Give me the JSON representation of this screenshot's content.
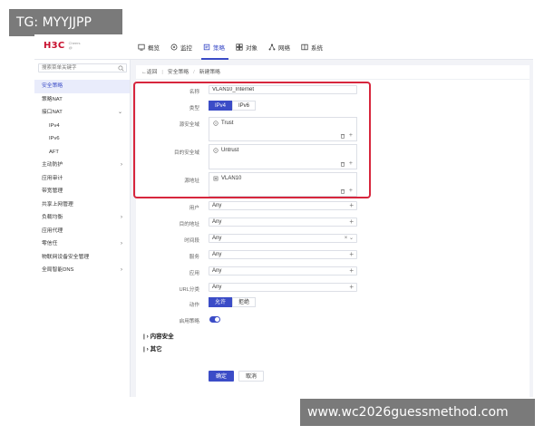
{
  "watermarks": {
    "top_left": "TG: MYYJJPP",
    "bottom_right": "www.wc2026guessmethod.com"
  },
  "brand": {
    "logo": "H3C",
    "sub": "Cheers\n@"
  },
  "nav": [
    {
      "label": "概览",
      "icon": "dashboard-icon"
    },
    {
      "label": "监控",
      "icon": "monitor-icon"
    },
    {
      "label": "策略",
      "icon": "policy-icon",
      "active": true
    },
    {
      "label": "对象",
      "icon": "object-icon"
    },
    {
      "label": "网络",
      "icon": "network-icon"
    },
    {
      "label": "系统",
      "icon": "system-icon"
    }
  ],
  "sidebar": {
    "search_placeholder": "搜索菜单关键字",
    "items": [
      {
        "label": "安全策略",
        "active": true
      },
      {
        "label": "策略NAT"
      },
      {
        "label": "接口NAT",
        "chevron": "⌄"
      },
      {
        "label": "IPv4",
        "sub": true
      },
      {
        "label": "IPv6",
        "sub": true
      },
      {
        "label": "AFT",
        "sub": true
      },
      {
        "label": "主动防护",
        "chevron": "›"
      },
      {
        "label": "应用审计"
      },
      {
        "label": "带宽管理"
      },
      {
        "label": "共享上网管理"
      },
      {
        "label": "负载均衡",
        "chevron": "›"
      },
      {
        "label": "应用代理"
      },
      {
        "label": "零信任",
        "chevron": "›"
      },
      {
        "label": "物联网设备安全管理"
      },
      {
        "label": "全局智能DNS",
        "chevron": "›"
      }
    ]
  },
  "breadcrumb": {
    "back": "←返回",
    "level1": "安全策略",
    "level2": "新建策略"
  },
  "form": {
    "name_label": "名称",
    "name_value": "VLAN10_Internet",
    "type_label": "类型",
    "type_opt1": "IPv4",
    "type_opt2": "IPv6",
    "src_zone_label": "源安全域",
    "src_zone_value": "Trust",
    "dst_zone_label": "目的安全域",
    "dst_zone_value": "Untrust",
    "src_addr_label": "源地址",
    "src_addr_value": "VLAN10",
    "user_label": "用户",
    "user_value": "Any",
    "dst_addr_label": "目的地址",
    "dst_addr_value": "Any",
    "time_label": "时间段",
    "time_value": "Any",
    "service_label": "服务",
    "service_value": "Any",
    "app_label": "应用",
    "app_value": "Any",
    "url_label": "URL分类",
    "url_value": "Any",
    "action_label": "动作",
    "action_opt1": "允许",
    "action_opt2": "拒绝",
    "enable_label": "启用策略",
    "section_content": "内容安全",
    "section_other": "其它",
    "ok": "确定",
    "cancel": "取消"
  }
}
